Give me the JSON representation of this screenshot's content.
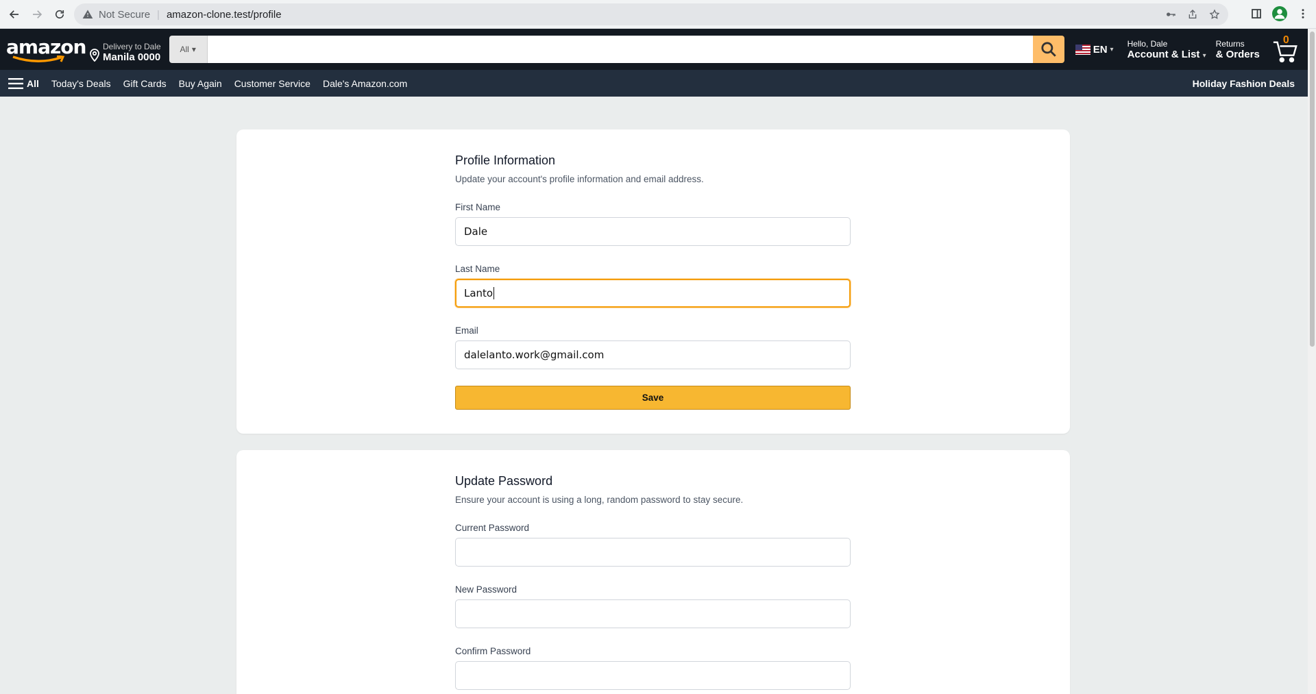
{
  "browser": {
    "security_label": "Not Secure",
    "url": "amazon-clone.test/profile"
  },
  "header": {
    "logo_text": "amazon",
    "delivery_small": "Delivery to Dale",
    "delivery_big": "Manila 0000",
    "search_dept": "All",
    "search_placeholder": "",
    "language": "EN",
    "greeting": "Hello, Dale",
    "account_label": "Account & List",
    "returns_small": "Returns",
    "returns_big": "& Orders",
    "cart_count": "0"
  },
  "subnav": {
    "all_label": "All",
    "items": [
      "Today's Deals",
      "Gift Cards",
      "Buy Again",
      "Customer Service",
      "Dale's Amazon.com"
    ],
    "promo": "Holiday Fashion Deals"
  },
  "profile": {
    "title": "Profile Information",
    "description": "Update your account's profile information and email address.",
    "first_name_label": "First Name",
    "first_name_value": "Dale",
    "last_name_label": "Last Name",
    "last_name_value": "Lanto",
    "email_label": "Email",
    "email_value": "dalelanto.work@gmail.com",
    "save_label": "Save"
  },
  "password": {
    "title": "Update Password",
    "description": "Ensure your account is using a long, random password to stay secure.",
    "current_label": "Current Password",
    "new_label": "New Password",
    "confirm_label": "Confirm Password"
  },
  "colors": {
    "header_bg": "#131921",
    "subnav_bg": "#232f3e",
    "search_button": "#febd69",
    "save_button": "#f7b731",
    "focus_ring": "#f59e0b"
  }
}
